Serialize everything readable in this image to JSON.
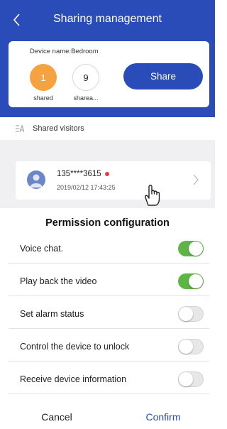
{
  "header": {
    "title": "Sharing management"
  },
  "device": {
    "name_label": "Device name:Bedroom",
    "shared_count": "1",
    "shared_label": "shared",
    "sharea_count": "9",
    "sharea_label": "sharea...",
    "share_button": "Share"
  },
  "visitors": {
    "section_label": "Shared visitors",
    "items": [
      {
        "phone": "135****3615",
        "date": "2019/02/12 17:43:25"
      }
    ]
  },
  "permissions": {
    "title": "Permission configuration",
    "items": [
      {
        "label": "Voice chat.",
        "enabled": true
      },
      {
        "label": "Play back the video",
        "enabled": true
      },
      {
        "label": "Set alarm status",
        "enabled": false
      },
      {
        "label": "Control the device to unlock",
        "enabled": false
      },
      {
        "label": "Receive device information",
        "enabled": false
      }
    ],
    "cancel_label": "Cancel",
    "confirm_label": "Confirm"
  },
  "colors": {
    "brand": "#2a4cb8",
    "toggle_on": "#5fb447",
    "shared_circle": "#f4a340",
    "online_dot": "#e83c3c"
  },
  "icons": [
    "back-icon",
    "visitors-icon",
    "avatar-icon",
    "chevron-right-icon",
    "hand-cursor-icon"
  ]
}
